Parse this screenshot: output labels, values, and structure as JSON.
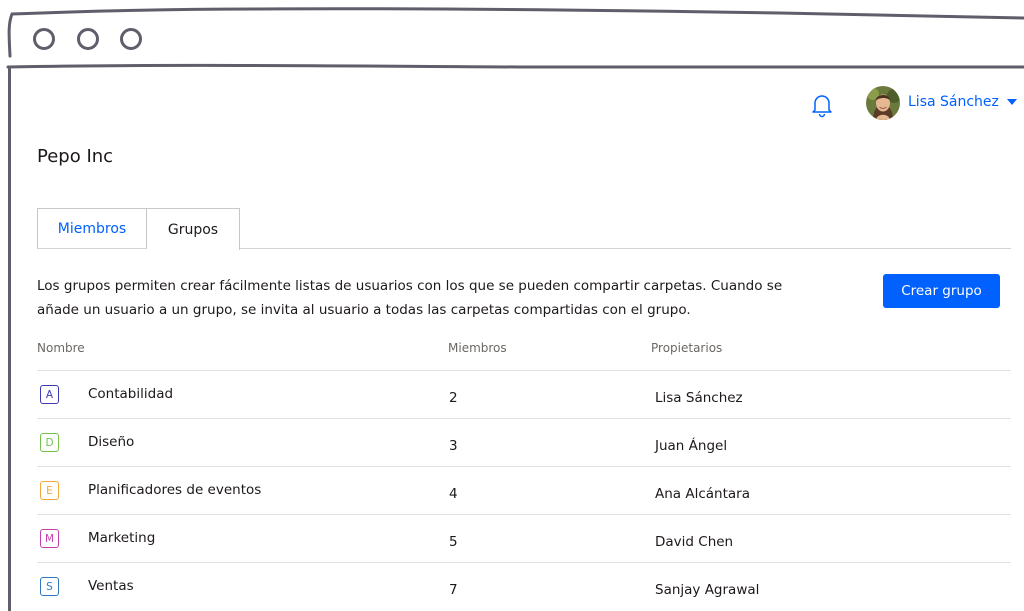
{
  "window": {
    "controls": [
      "close",
      "minimize",
      "maximize"
    ]
  },
  "header": {
    "notification_icon": "bell-icon",
    "user_name": "Lisa Sánchez",
    "avatar": "user-avatar"
  },
  "page": {
    "title": "Pepo Inc"
  },
  "tabs": [
    {
      "label": "Miembros",
      "active": false
    },
    {
      "label": "Grupos",
      "active": true
    }
  ],
  "groups_panel": {
    "description": "Los grupos permiten crear fácilmente listas de usuarios con los que se pueden compartir carpetas. Cuando se añade un usuario a un grupo, se invita al usuario a todas las carpetas compartidas con el grupo.",
    "create_button": "Crear grupo",
    "columns": {
      "name": "Nombre",
      "members": "Miembros",
      "owners": "Propietarios"
    },
    "rows": [
      {
        "initial": "A",
        "name": "Contabilidad",
        "members": "2",
        "owner": "Lisa Sánchez",
        "color": "#3d3ab3"
      },
      {
        "initial": "D",
        "name": "Diseño",
        "members": "3",
        "owner": "Juan Ángel",
        "color": "#73c04b"
      },
      {
        "initial": "E",
        "name": "Planificadores de eventos",
        "members": "4",
        "owner": "Ana Alcántara",
        "color": "#f4a73c"
      },
      {
        "initial": "M",
        "name": "Marketing",
        "members": "5",
        "owner": "David Chen",
        "color": "#c63fae"
      },
      {
        "initial": "S",
        "name": "Ventas",
        "members": "7",
        "owner": "Sanjay Agrawal",
        "color": "#2f77c1"
      }
    ]
  },
  "colors": {
    "accent": "#0061fe",
    "frame": "#5f5e6b",
    "divider": "#e2e0dd"
  }
}
